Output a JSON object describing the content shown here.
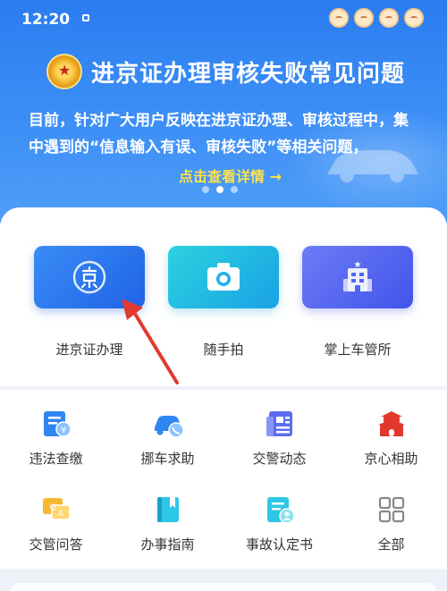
{
  "status_bar": {
    "time": "12:20"
  },
  "banner": {
    "title": "进京证办理审核失败常见问题",
    "text": "目前，针对广大用户反映在进京证办理、审核过程中，集中遇到的“信息输入有误、审核失败”等相关问题，",
    "link": "点击查看详情 →",
    "active_slide": 1,
    "slide_count": 3
  },
  "main_services": [
    {
      "label": "进京证办理",
      "icon": "jing-seal-icon"
    },
    {
      "label": "随手拍",
      "icon": "camera-icon"
    },
    {
      "label": "掌上车管所",
      "icon": "building-icon"
    }
  ],
  "services": [
    {
      "label": "违法查缴",
      "icon": "fine-payment-icon"
    },
    {
      "label": "挪车求助",
      "icon": "move-car-icon"
    },
    {
      "label": "交警动态",
      "icon": "news-icon"
    },
    {
      "label": "京心相助",
      "icon": "tiananmen-icon"
    },
    {
      "label": "交管问答",
      "icon": "qa-icon"
    },
    {
      "label": "办事指南",
      "icon": "guide-book-icon"
    },
    {
      "label": "事故认定书",
      "icon": "accident-report-icon"
    },
    {
      "label": "全部",
      "icon": "grid-all-icon"
    }
  ],
  "colors": {
    "banner": "#3d8ff6",
    "link": "#ffe14d",
    "arrow": "#e23b2e"
  }
}
